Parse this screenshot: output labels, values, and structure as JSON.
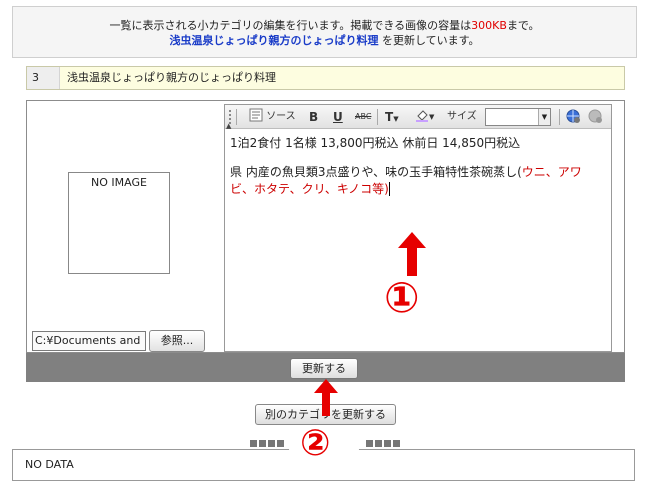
{
  "info": {
    "line1_pre": "一覧に表示される小カテゴリの編集を行います。掲載できる画像の容量は",
    "line1_size": "300KB",
    "line1_post": "まで。",
    "line2_name": "浅虫温泉じょっぱり親方のじょっぱり料理",
    "line2_post": " を更新しています。"
  },
  "category": {
    "number": "3",
    "name": "浅虫温泉じょっぱり親方のじょっぱり料理"
  },
  "image": {
    "placeholder": "NO IMAGE",
    "file_path": "C:¥Documents and",
    "browse_label": "参照..."
  },
  "editor": {
    "toolbar": {
      "source_label": "ソース",
      "bold_label": "B",
      "underline_label": "U",
      "strike_label": "ABC",
      "text_color_label": "T",
      "bg_color_label": "B",
      "size_label": "サイズ",
      "size_value": ""
    },
    "line1": "1泊2食付 1名様 13,800円税込 休前日 14,850円税込",
    "line2_black": "県 内産の魚貝類3点盛りや、味の玉手箱特性茶碗蒸し(",
    "line2_red": "ウニ、アワビ、ホタテ、クリ、キノコ等",
    "line2_end": ")"
  },
  "buttons": {
    "update": "更新する",
    "other_category": "別のカテゴリを更新する"
  },
  "nodata": "NO DATA",
  "annotations": {
    "step1": "①",
    "step2": "②"
  },
  "colors": {
    "accent_red": "#e00000",
    "link_blue": "#1a3cc8",
    "footer_bar": "#808080"
  }
}
